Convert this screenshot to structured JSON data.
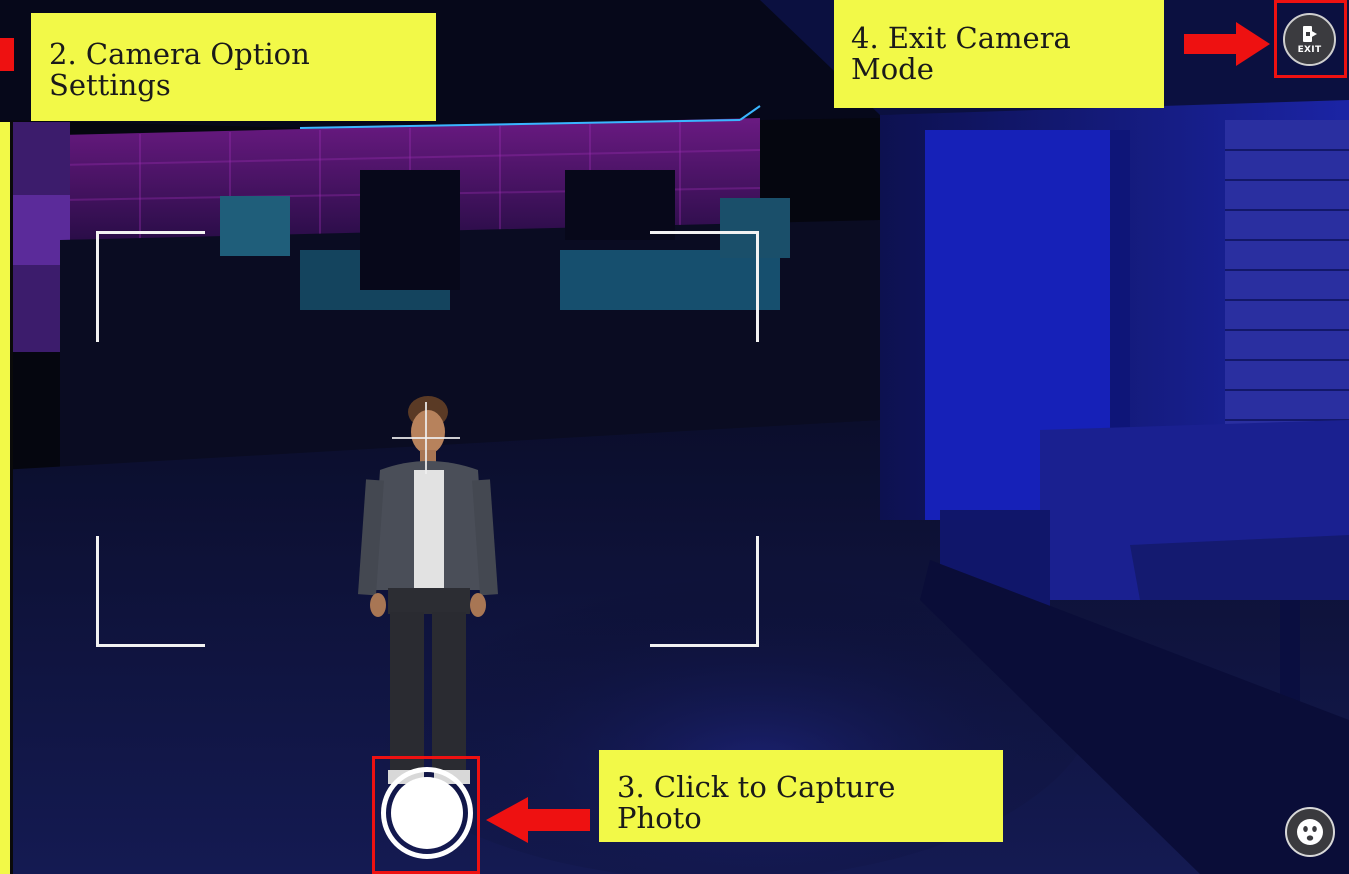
{
  "annotations": {
    "camera_settings": "2. Camera Option Settings",
    "exit_camera": "4. Exit Camera Mode",
    "capture_photo": "3. Click to Capture Photo"
  },
  "controls": {
    "exit_button_label": "EXIT",
    "exit_icon": "exit-door-icon",
    "capture_icon": "shutter-icon",
    "emote_icon": "smiley-face-icon"
  },
  "colors": {
    "annotation_yellow": "#f2f948",
    "highlight_red": "#ee1111",
    "scene_blue": "#1b22a8",
    "scene_magenta": "#8a1f9c"
  }
}
